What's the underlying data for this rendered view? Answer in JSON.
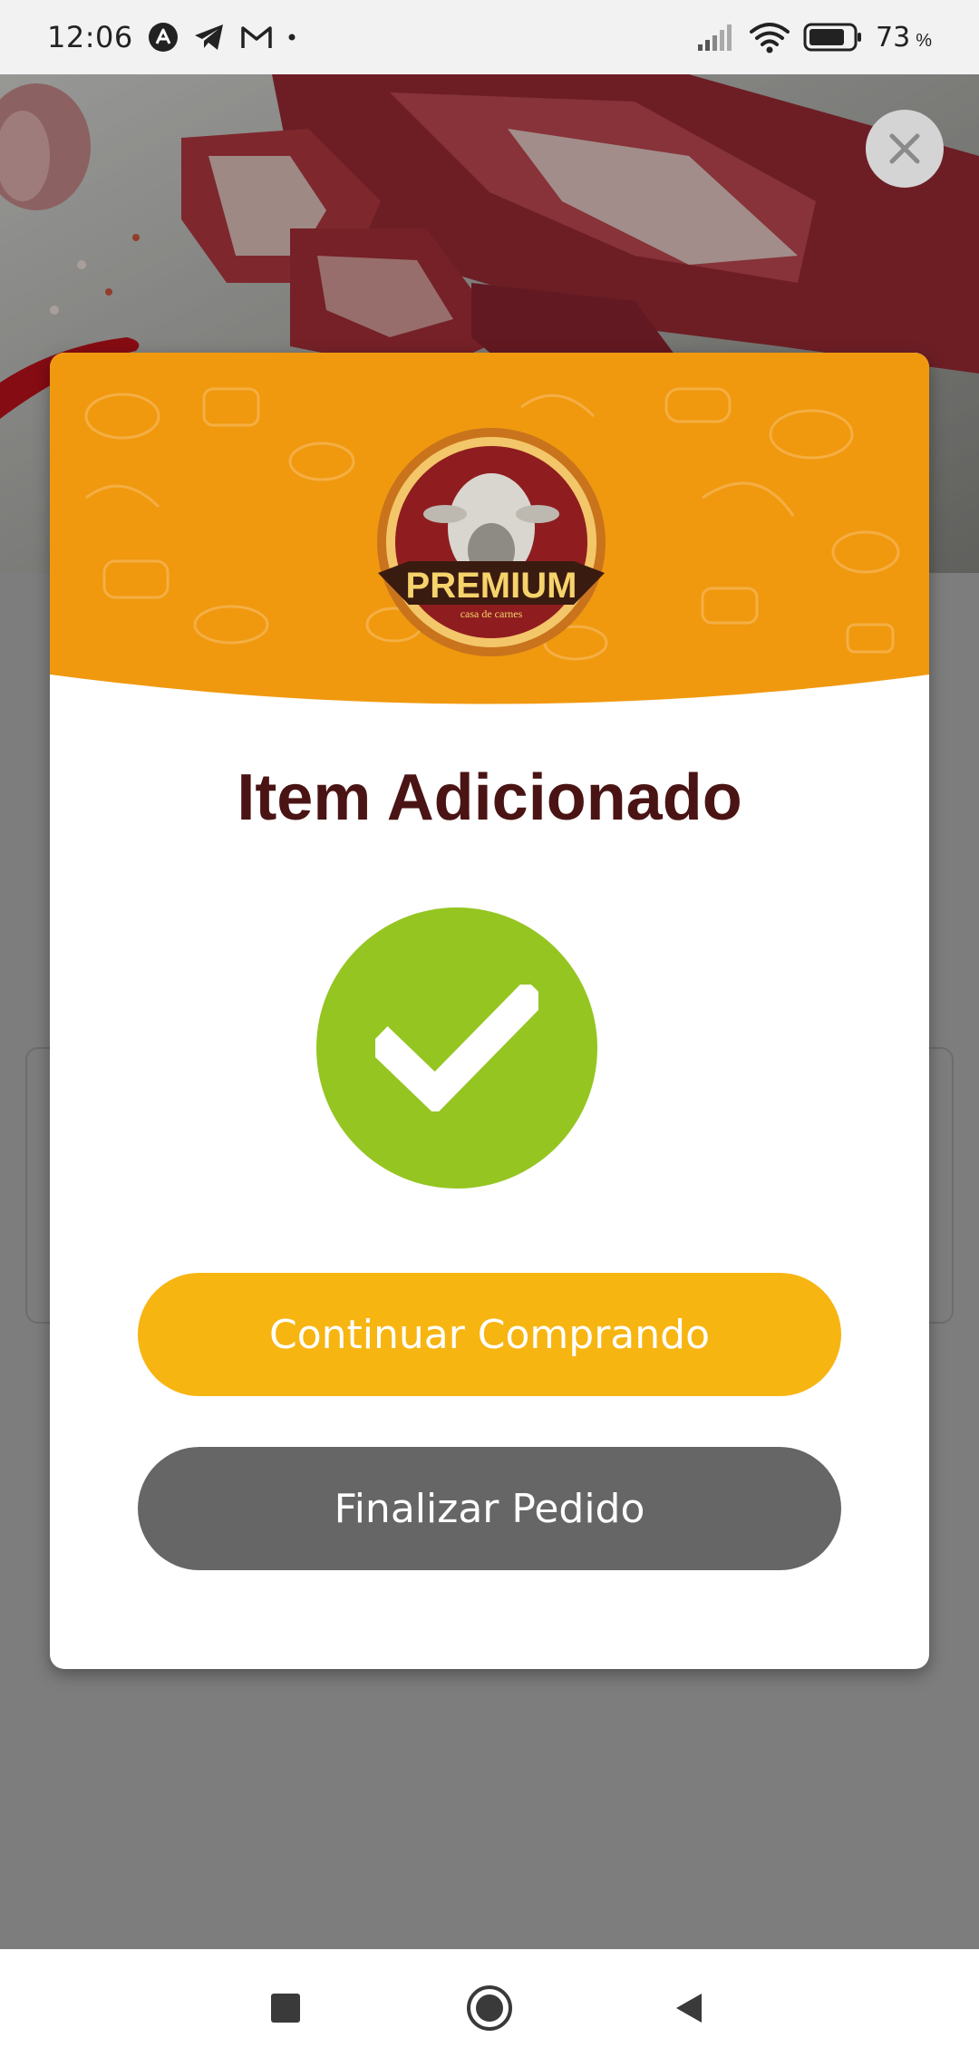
{
  "status_bar": {
    "time": "12:06",
    "battery_level": "73",
    "battery_unit": "%",
    "notification_icons": [
      "arch-app-icon",
      "telegram-icon",
      "gmail-icon",
      "dot-icon"
    ],
    "system_icons": [
      "signal-icon",
      "wifi-icon",
      "battery-icon"
    ]
  },
  "modal": {
    "brand_logo_text": "PREMIUM",
    "brand_logo_subtext": "casa de carnes",
    "title": "Item Adicionado",
    "continue_label": "Continuar Comprando",
    "finish_label": "Finalizar Pedido"
  },
  "colors": {
    "header_orange": "#F0990F",
    "title_brown": "#4A1414",
    "success_green": "#95C521",
    "continue_yellow": "#F7B512",
    "finish_gray": "#666666"
  },
  "nav_bar": {
    "icons": [
      "recents-square-icon",
      "home-circle-icon",
      "back-triangle-icon"
    ]
  }
}
